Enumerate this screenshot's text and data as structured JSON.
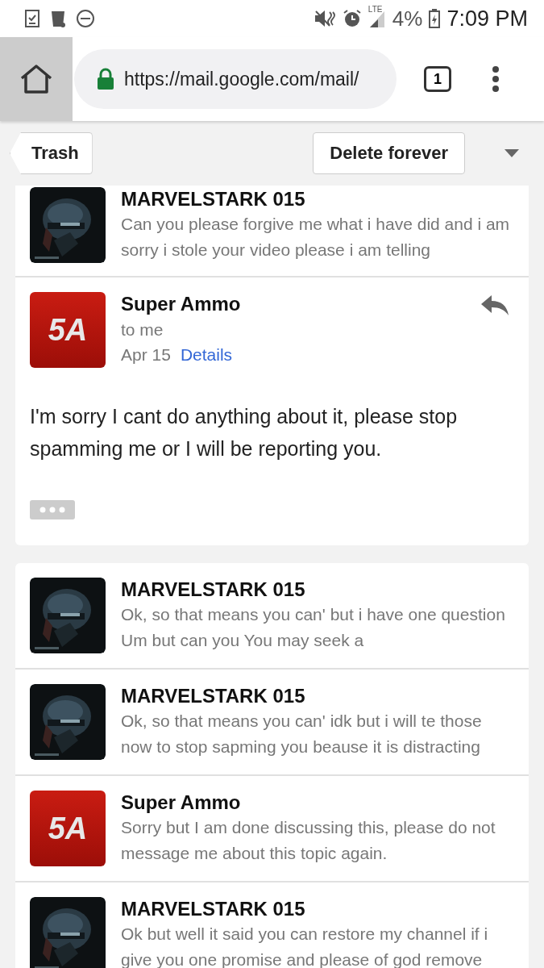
{
  "status_bar": {
    "network": "LTE",
    "battery": "4%",
    "time": "7:09 PM"
  },
  "browser": {
    "url": "https://mail.google.com/mail/",
    "tab_count": "1"
  },
  "toolbar": {
    "back_label": "Trash",
    "action": "Delete forever"
  },
  "thread_top": {
    "sender": "MARVELSTARK 015",
    "snippet": "Can you please forgive me what i have did and i am sorry i stole your video please i am telling"
  },
  "open_message": {
    "sender": "Super Ammo",
    "avatar": {
      "kind": "logo",
      "text": "5A"
    },
    "recipient": "to me",
    "date": "Apr 15",
    "details_link": "Details",
    "body": "I'm sorry I cant do anything about it, please stop spamming me or I will be reporting you."
  },
  "messages": [
    {
      "sender": "MARVELSTARK 015",
      "snippet": "Ok, so that means you can' but i have one question Um but can you You may seek a"
    },
    {
      "sender": "MARVELSTARK 015",
      "snippet": "Ok, so that means you can' idk but i will te those now to stop sapming you beause it is distracting"
    },
    {
      "sender": "Super Ammo",
      "snippet": "Sorry but I am done discussing this, please do not message me about this topic again.",
      "avatar": {
        "kind": "logo",
        "text": "5A"
      }
    },
    {
      "sender": "MARVELSTARK 015",
      "snippet": "Ok but well it said you can restore my channel if i give you one promise and please of god remove"
    }
  ]
}
